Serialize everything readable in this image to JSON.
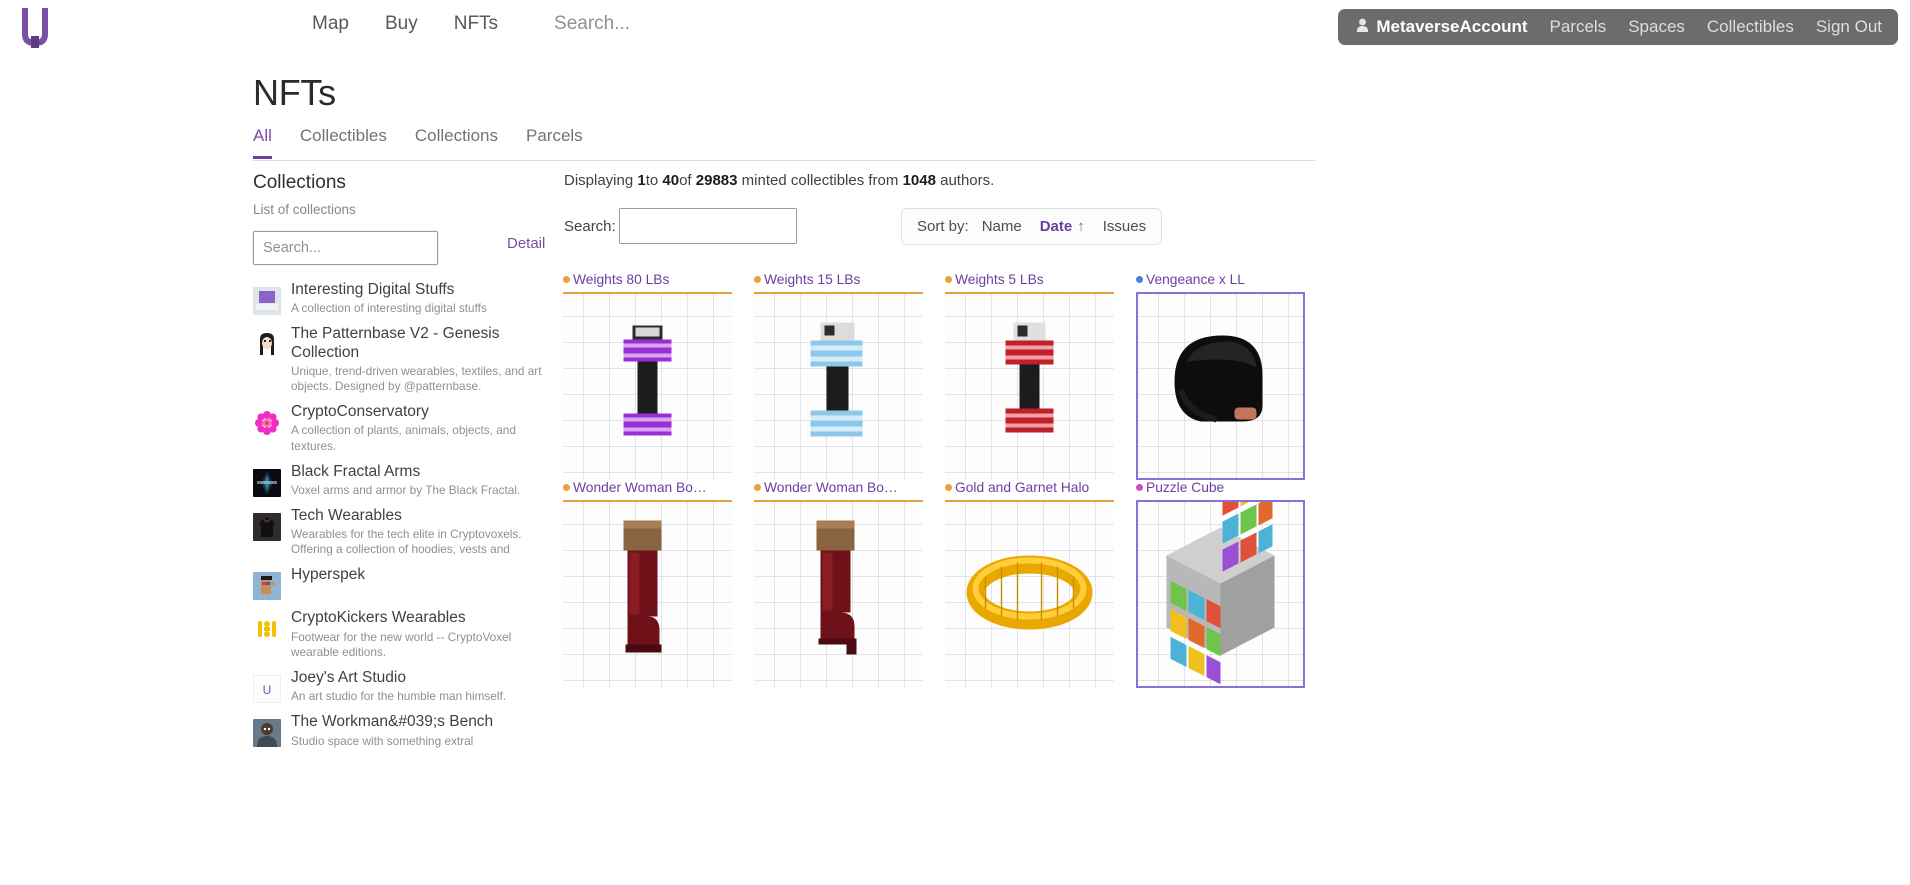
{
  "nav": {
    "logo_name": "cryptovoxels-logo",
    "links": [
      {
        "label": "Map",
        "name": "nav-map"
      },
      {
        "label": "Buy",
        "name": "nav-buy"
      },
      {
        "label": "NFTs",
        "name": "nav-nfts"
      }
    ],
    "search_text": "Search...",
    "account": {
      "username": "MetaverseAccount",
      "links": [
        "Parcels",
        "Spaces",
        "Collectibles",
        "Sign Out"
      ],
      "bg_color": "#6c6c6c"
    }
  },
  "page": {
    "title": "NFTs",
    "tabs": [
      {
        "label": "All",
        "active": true
      },
      {
        "label": "Collectibles",
        "active": false
      },
      {
        "label": "Collections",
        "active": false
      },
      {
        "label": "Parcels",
        "active": false
      }
    ],
    "accent_color": "#6b3fa0"
  },
  "sidebar": {
    "heading": "Collections",
    "subheading": "List of collections",
    "search_placeholder": "Search...",
    "search_value": "",
    "detail_link": "Detail",
    "items": [
      {
        "name": "Interesting Digital Stuffs",
        "description": "A collection of interesting digital stuffs",
        "thumb": "digital-stuffs"
      },
      {
        "name": "The Patternbase V2 - Genesis Collection",
        "description": "Unique, trend-driven wearables, textiles, and art objects. Designed by @patternbase.",
        "thumb": "patternbase-avatar"
      },
      {
        "name": "CryptoConservatory",
        "description": "A collection of plants, animals, objects, and textures.",
        "thumb": "pink-flower"
      },
      {
        "name": "Black Fractal Arms",
        "description": "Voxel arms and armor by The Black Fractal.",
        "thumb": "black-fractal"
      },
      {
        "name": "Tech Wearables",
        "description": "Wearables for the tech elite in Cryptovoxels. Offering a collection of hoodies, vests and",
        "thumb": "tech-hoodie"
      },
      {
        "name": "Hyperspek",
        "description": "",
        "thumb": "hyperspek-avatar"
      },
      {
        "name": "CryptoKickers Wearables",
        "description": "Footwear for the new world -- CryptoVoxel wearable editions.",
        "thumb": "cryptokickers"
      },
      {
        "name": "Joey's Art Studio",
        "description": "An art studio for the humble man himself.",
        "thumb": "joey-letter"
      },
      {
        "name": "The Workman&#039;s Bench",
        "description": "Studio space with something extral",
        "thumb": "workman-avatar"
      }
    ]
  },
  "main": {
    "displaying": {
      "prefix": "Displaying ",
      "from": "1",
      "mid1": "to ",
      "to": "40",
      "mid2": "of ",
      "total": "29883",
      "mid3": " minted collectibles from ",
      "authors": "1048",
      "suffix": " authors."
    },
    "search_label": "Search:",
    "search_value": "",
    "sort": {
      "label": "Sort by:",
      "options": [
        {
          "label": "Name",
          "active": false
        },
        {
          "label": "Date",
          "active": true
        },
        {
          "label": "Issues",
          "active": false
        }
      ],
      "arrow": "↑"
    }
  },
  "grid": {
    "cards": [
      {
        "title": "Weights 80 LBs",
        "dot_color": "#e8a33c",
        "border_color": "#e0a33c",
        "art": "dumbbell-purple",
        "highlight": false
      },
      {
        "title": "Weights 15 LBs",
        "dot_color": "#e8a33c",
        "border_color": "#e0a33c",
        "art": "dumbbell-blue",
        "highlight": false
      },
      {
        "title": "Weights 5 LBs",
        "dot_color": "#e8a33c",
        "border_color": "#e0a33c",
        "art": "dumbbell-red",
        "highlight": false
      },
      {
        "title": "Vengeance x LL",
        "dot_color": "#4a7fe0",
        "border_color": "#8a6fd6",
        "art": "black-helmet",
        "highlight": true
      },
      {
        "title": "Wonder Woman Bo…",
        "dot_color": "#e8a33c",
        "border_color": "#e0a33c",
        "art": "boot-red-1",
        "highlight": false
      },
      {
        "title": "Wonder Woman Bo…",
        "dot_color": "#e8a33c",
        "border_color": "#e0a33c",
        "art": "boot-red-2",
        "highlight": false
      },
      {
        "title": "Gold and Garnet Halo",
        "dot_color": "#e8a33c",
        "border_color": "#e0a33c",
        "art": "gold-halo",
        "highlight": false
      },
      {
        "title": "Puzzle Cube",
        "dot_color": "#d04fc0",
        "border_color": "#8a6fd6",
        "art": "puzzle-cube",
        "highlight": true
      }
    ]
  }
}
